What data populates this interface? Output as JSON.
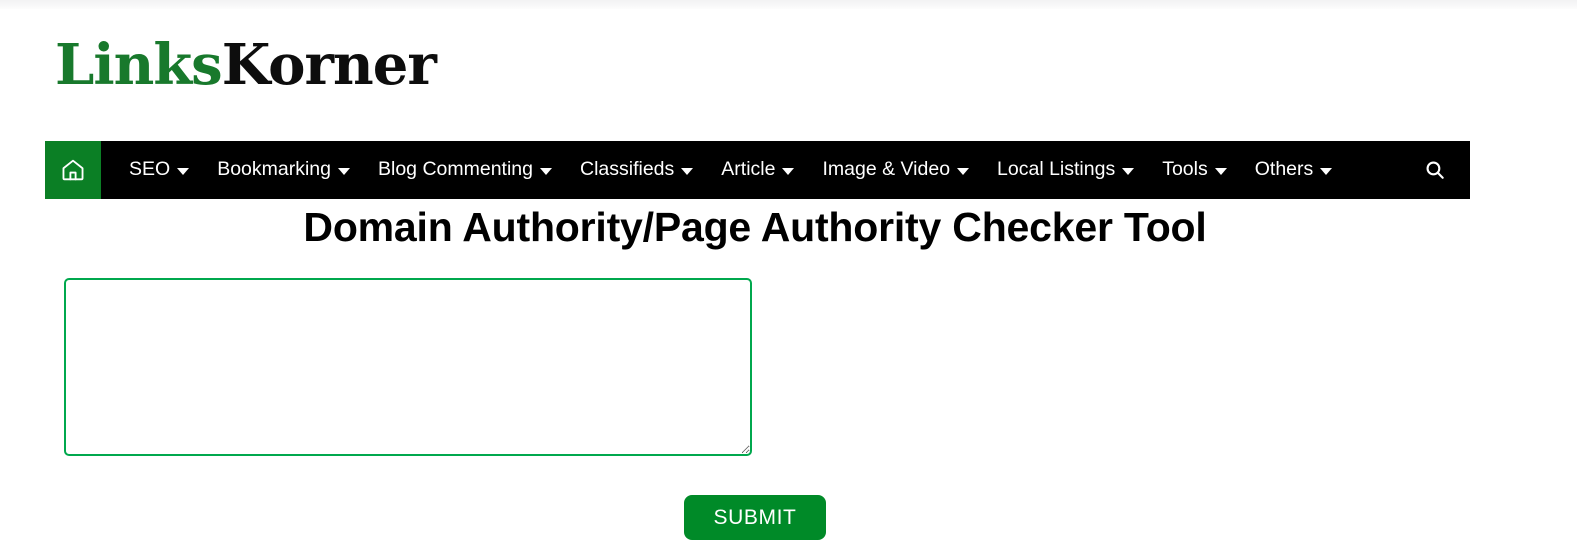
{
  "header": {
    "logo": {
      "part_one": "Links",
      "part_two": "Korner",
      "color_one": "#18792c",
      "color_two": "#0d0d0d"
    }
  },
  "nav": {
    "background": "#000000",
    "home_accent": "#0b7f25",
    "home_icon": "home-icon",
    "search_icon": "search-icon",
    "items": [
      {
        "label": "SEO",
        "has_dropdown": true
      },
      {
        "label": "Bookmarking",
        "has_dropdown": true
      },
      {
        "label": "Blog Commenting",
        "has_dropdown": true
      },
      {
        "label": "Classifieds",
        "has_dropdown": true
      },
      {
        "label": "Article",
        "has_dropdown": true
      },
      {
        "label": "Image & Video",
        "has_dropdown": true
      },
      {
        "label": "Local Listings",
        "has_dropdown": true
      },
      {
        "label": "Tools",
        "has_dropdown": true
      },
      {
        "label": "Others",
        "has_dropdown": true
      }
    ]
  },
  "main": {
    "title": "Domain Authority/Page Authority Checker Tool",
    "input": {
      "value": "",
      "placeholder": ""
    },
    "submit_label": "SUBMIT",
    "submit_color": "#008a28",
    "input_border_color": "#00a84d"
  }
}
